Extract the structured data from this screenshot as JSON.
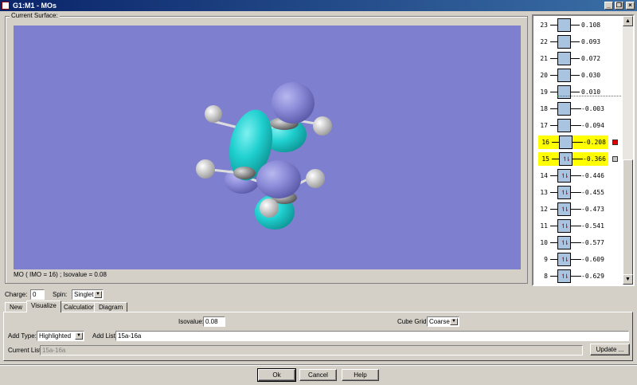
{
  "window": {
    "title": "G1:M1 - MOs",
    "controls": [
      "minimize",
      "restore",
      "close"
    ]
  },
  "surface": {
    "group_label": "Current Surface:",
    "status": "MO ( IMO = 16) ; Isovalue = 0.08",
    "background": "#7f7fcf",
    "lobe_colors": {
      "positive": "#20d0d0",
      "negative": "#8a8ad8"
    }
  },
  "orbitals": [
    {
      "n": "23",
      "energy": "0.108",
      "occupied": false
    },
    {
      "n": "22",
      "energy": "0.093",
      "occupied": false
    },
    {
      "n": "21",
      "energy": "0.072",
      "occupied": false
    },
    {
      "n": "20",
      "energy": "0.030",
      "occupied": false
    },
    {
      "n": "19",
      "energy": "0.010",
      "occupied": false
    },
    {
      "n": "18",
      "energy": "-0.003",
      "occupied": false
    },
    {
      "n": "17",
      "energy": "-0.094",
      "occupied": false
    },
    {
      "n": "16",
      "energy": "-0.208",
      "occupied": false,
      "highlighted": true,
      "marker": "#e00000"
    },
    {
      "n": "15",
      "energy": "-0.366",
      "occupied": true,
      "highlighted": true,
      "marker": "#c8c8c8"
    },
    {
      "n": "14",
      "energy": "-0.446",
      "occupied": true
    },
    {
      "n": "13",
      "energy": "-0.455",
      "occupied": true
    },
    {
      "n": "12",
      "energy": "-0.473",
      "occupied": true
    },
    {
      "n": "11",
      "energy": "-0.541",
      "occupied": true
    },
    {
      "n": "10",
      "energy": "-0.577",
      "occupied": true
    },
    {
      "n": "9",
      "energy": "-0.609",
      "occupied": true
    },
    {
      "n": "8",
      "energy": "-0.629",
      "occupied": true
    }
  ],
  "electron_glyph": "↿⇂",
  "charge": {
    "label": "Charge:",
    "value": "0"
  },
  "spin": {
    "label": "Spin:",
    "value": "Singlet"
  },
  "tabs": [
    {
      "label": "New"
    },
    {
      "label": "Visualize",
      "active": true
    },
    {
      "label": "Calculation"
    },
    {
      "label": "Diagram"
    }
  ],
  "visualize": {
    "isovalue_label": "Isovalue:",
    "isovalue": "0.08",
    "cube_grid_label": "Cube Grid:",
    "cube_grid": "Coarse",
    "add_type_label": "Add Type:",
    "add_type": "Highlighted",
    "add_list_label": "Add List:",
    "add_list": "15a-16a",
    "current_list_label": "Current List:",
    "current_list": "15a-16a",
    "update_label": "Update ..."
  },
  "buttons": {
    "ok": "Ok",
    "cancel": "Cancel",
    "help": "Help"
  }
}
